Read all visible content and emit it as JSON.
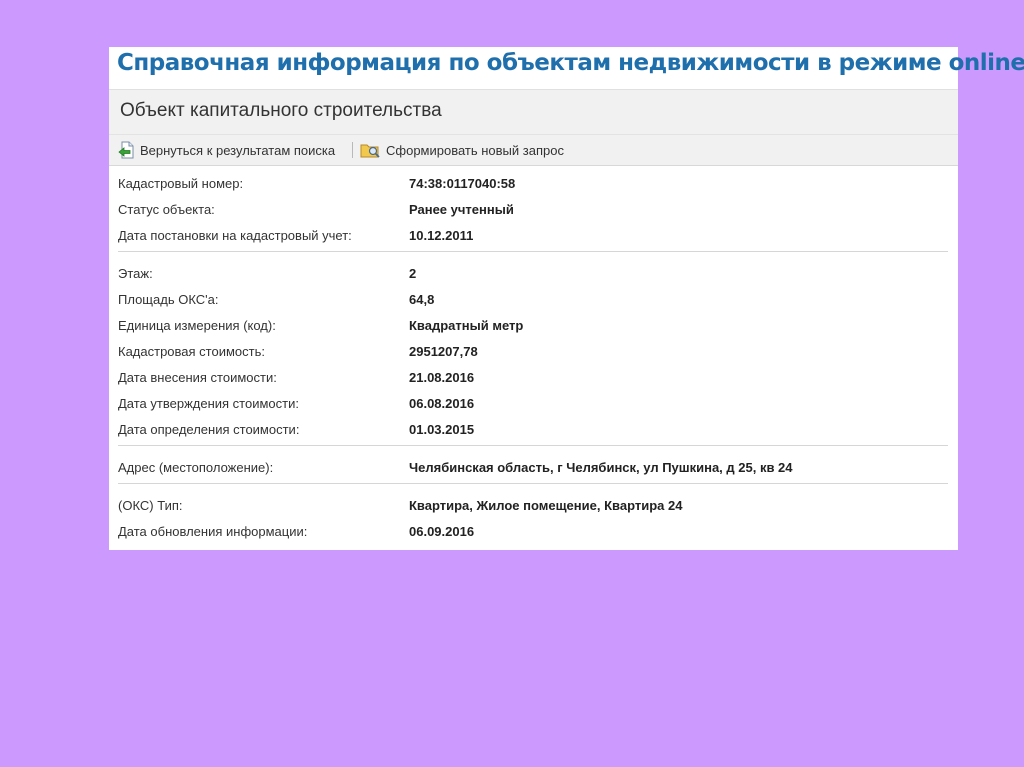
{
  "page_title": "Справочная информация по объектам недвижимости в режиме online",
  "section_title": "Объект капитального строительства",
  "toolbar": {
    "back_label": "Вернуться к результатам поиска",
    "new_request_label": "Сформировать новый запрос"
  },
  "groups": [
    [
      {
        "label": "Кадастровый номер:",
        "value": "74:38:0117040:58"
      },
      {
        "label": "Статус объекта:",
        "value": "Ранее учтенный"
      },
      {
        "label": "Дата постановки на кадастровый учет:",
        "value": "10.12.2011"
      }
    ],
    [
      {
        "label": "Этаж:",
        "value": "2"
      },
      {
        "label": "Площадь ОКС'а:",
        "value": "64,8"
      },
      {
        "label": "Единица измерения (код):",
        "value": "Квадратный метр"
      },
      {
        "label": "Кадастровая стоимость:",
        "value": "2951207,78"
      },
      {
        "label": "Дата внесения стоимости:",
        "value": "21.08.2016"
      },
      {
        "label": "Дата утверждения стоимости:",
        "value": "06.08.2016"
      },
      {
        "label": "Дата определения стоимости:",
        "value": "01.03.2015"
      }
    ],
    [
      {
        "label": "Адрес (местоположение):",
        "value": "Челябинская область, г Челябинск, ул Пушкина, д 25, кв 24"
      }
    ],
    [
      {
        "label": "(ОКС) Тип:",
        "value": "Квартира, Жилое помещение, Квартира 24"
      },
      {
        "label": "Дата обновления информации:",
        "value": "06.09.2016"
      }
    ]
  ]
}
